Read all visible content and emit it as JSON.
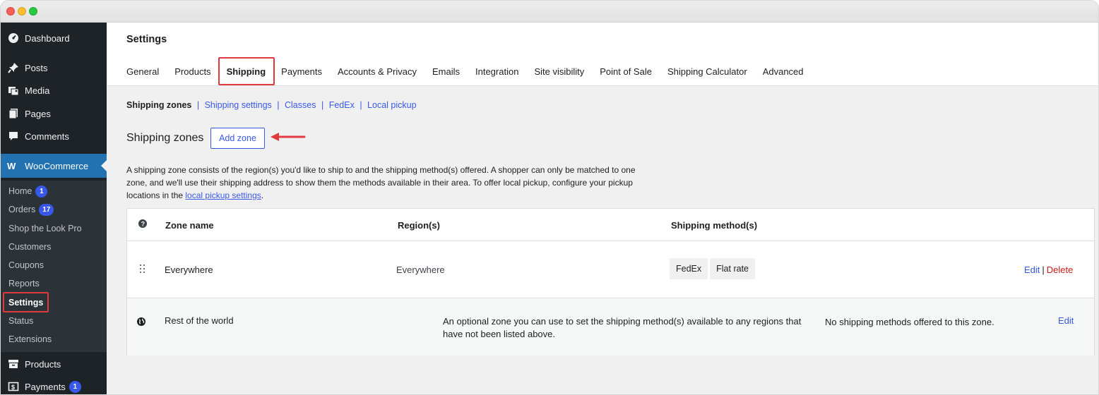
{
  "sidebar": {
    "top_items": [
      {
        "label": "Dashboard",
        "icon": "dashboard-icon"
      },
      {
        "label": "Posts",
        "icon": "pin-icon"
      },
      {
        "label": "Media",
        "icon": "media-icon"
      },
      {
        "label": "Pages",
        "icon": "pages-icon"
      },
      {
        "label": "Comments",
        "icon": "comment-icon"
      },
      {
        "label": "WooCommerce",
        "icon": "woo-icon"
      }
    ],
    "sub_items": [
      {
        "label": "Home",
        "badge": "1"
      },
      {
        "label": "Orders",
        "badge": "17"
      },
      {
        "label": "Shop the Look Pro"
      },
      {
        "label": "Customers"
      },
      {
        "label": "Coupons"
      },
      {
        "label": "Reports"
      },
      {
        "label": "Settings"
      },
      {
        "label": "Status"
      },
      {
        "label": "Extensions"
      }
    ],
    "bottom_items": [
      {
        "label": "Products",
        "icon": "archive-icon"
      },
      {
        "label": "Payments",
        "icon": "payments-icon",
        "badge": "1"
      }
    ]
  },
  "header": {
    "title": "Settings",
    "tabs": [
      "General",
      "Products",
      "Shipping",
      "Payments",
      "Accounts & Privacy",
      "Emails",
      "Integration",
      "Site visibility",
      "Point of Sale",
      "Shipping Calculator",
      "Advanced"
    ]
  },
  "subnav": [
    "Shipping zones",
    "Shipping settings",
    "Classes",
    "FedEx",
    "Local pickup"
  ],
  "zones": {
    "heading": "Shipping zones",
    "add_button": "Add zone",
    "description_before": "A shipping zone consists of the region(s) you'd like to ship to and the shipping method(s) offered. A shopper can only be matched to one zone, and we'll use their shipping address to show them the methods available in their area. To offer local pickup, configure your pickup locations in the ",
    "description_link": "local pickup settings",
    "description_after": "."
  },
  "table": {
    "headers": {
      "zone_name": "Zone name",
      "regions": "Region(s)",
      "methods": "Shipping method(s)"
    },
    "rows": [
      {
        "zone": "Everywhere",
        "region": "Everywhere",
        "methods": [
          "FedEx",
          "Flat rate"
        ],
        "edit": "Edit",
        "sep": "|",
        "delete": "Delete"
      },
      {
        "zone": "Rest of the world",
        "description": "An optional zone you can use to set the shipping method(s) available to any regions that have not been listed above.",
        "no_methods": "No shipping methods offered to this zone.",
        "edit": "Edit"
      }
    ]
  },
  "colors": {
    "accent": "#3858e9",
    "highlight": "#e0393e",
    "sidebar_bg": "#1d2327",
    "woo_active": "#2271b1"
  }
}
